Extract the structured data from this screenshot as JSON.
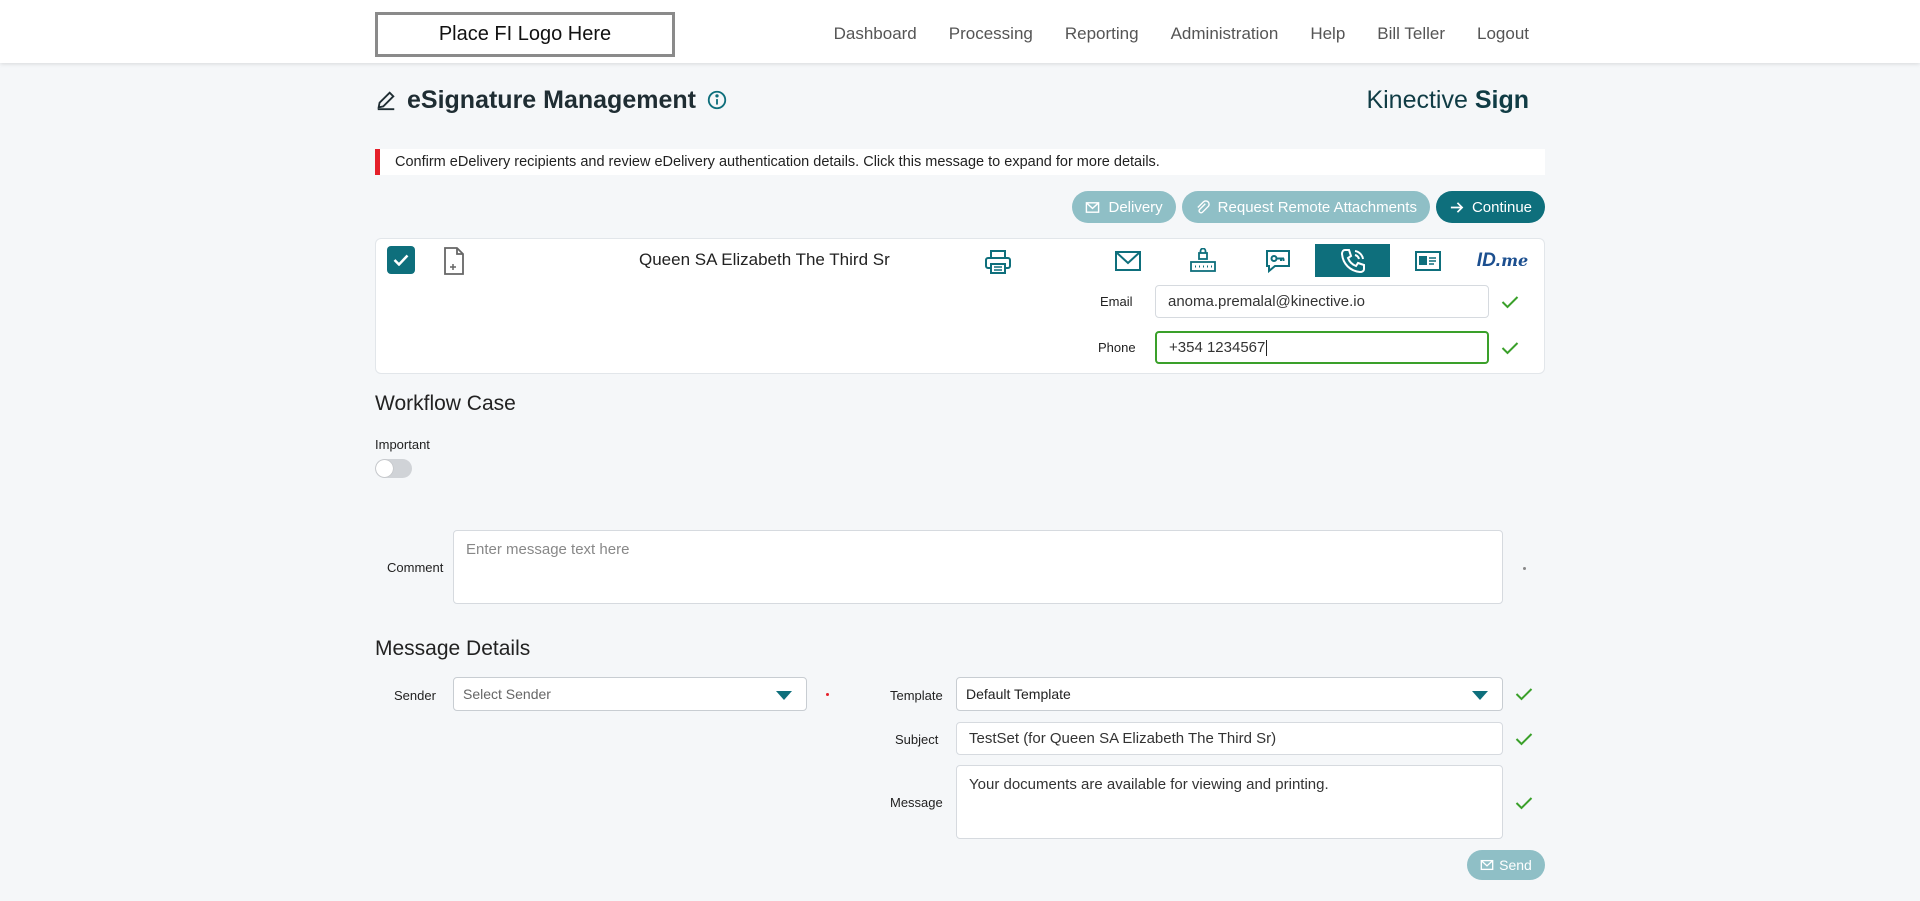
{
  "header": {
    "logo_text": "Place FI Logo Here",
    "nav": [
      "Dashboard",
      "Processing",
      "Reporting",
      "Administration",
      "Help",
      "Bill Teller",
      "Logout"
    ]
  },
  "page": {
    "title": "eSignature Management",
    "brand_light": "Kinective ",
    "brand_bold": "Sign"
  },
  "banner": {
    "text": "Confirm eDelivery recipients and review eDelivery authentication details. Click this message to expand for more details."
  },
  "actions": {
    "delivery": "Delivery",
    "remote": "Request Remote Attachments",
    "continue": "Continue"
  },
  "recipient": {
    "name": "Queen SA Elizabeth The Third Sr",
    "methods": [
      "email-icon",
      "sms-lock-icon",
      "chat-key-icon",
      "phone-icon",
      "id-card-icon",
      "idme-logo"
    ],
    "active_method": "phone-icon",
    "idme_id": "ID.",
    "idme_me": "me",
    "email_label": "Email",
    "email_value": "anoma.premalal@kinective.io",
    "phone_label": "Phone",
    "phone_value": "+354 1234567"
  },
  "workflow": {
    "heading": "Workflow Case",
    "important_label": "Important",
    "important_on": false,
    "comment_label": "Comment",
    "comment_placeholder": "Enter message text here"
  },
  "message": {
    "heading": "Message Details",
    "sender_label": "Sender",
    "sender_placeholder": "Select Sender",
    "template_label": "Template",
    "template_value": "Default Template",
    "subject_label": "Subject",
    "subject_value": "TestSet (for Queen SA Elizabeth The Third Sr)",
    "message_label": "Message",
    "message_value": "Your documents are available for viewing and printing.",
    "send": "Send"
  },
  "colors": {
    "primary": "#0e6f7c",
    "primary_muted": "#8fbfc6",
    "alert": "#e5202a",
    "valid": "#3aa02a"
  }
}
